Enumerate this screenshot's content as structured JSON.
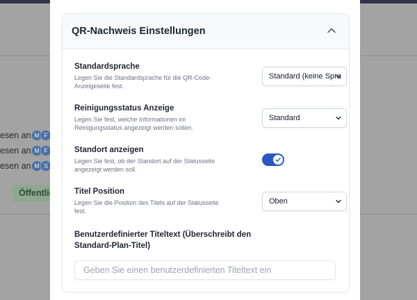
{
  "background": {
    "rows": [
      {
        "label": "esen an:",
        "avatars": [
          "M",
          "F"
        ]
      },
      {
        "label": "esen an:",
        "avatars": [
          "M",
          "F"
        ]
      },
      {
        "label": "esen an:",
        "avatars": [
          "M",
          "S"
        ]
      }
    ],
    "badge": "Öffentlic"
  },
  "card": {
    "title": "QR-Nachweis Einstellungen",
    "settings": [
      {
        "label": "Standardsprache",
        "description": "Legen Sie die Standardsprache für die QR-Code-Anzeigeseite fest.",
        "value": "Standard (keine Spra"
      },
      {
        "label": "Reinigungsstatus Anzeige",
        "description": "Legen Sie fest, welche Informationen im Reinigungsstatus angezeigt werden sollen.",
        "value": "Standard"
      },
      {
        "label": "Standort anzeigen",
        "description": "Legen Sie fest, ob der Standort auf der Statusseite angezeigt werden soll.",
        "toggle_on": true
      },
      {
        "label": "Titel Position",
        "description": "Legen Sie die Position des Titels auf der Statusseite fest.",
        "value": "Oben"
      }
    ],
    "custom_title": {
      "label": "Benutzerdefinierter Titeltext (Überschreibt den Standard-Plan-Titel)",
      "value": "",
      "placeholder": "Geben Sie einen benutzerdefinierten Titeltext ein"
    }
  },
  "colors": {
    "accent": "#2a56c6",
    "badge": "#8ea88f"
  }
}
